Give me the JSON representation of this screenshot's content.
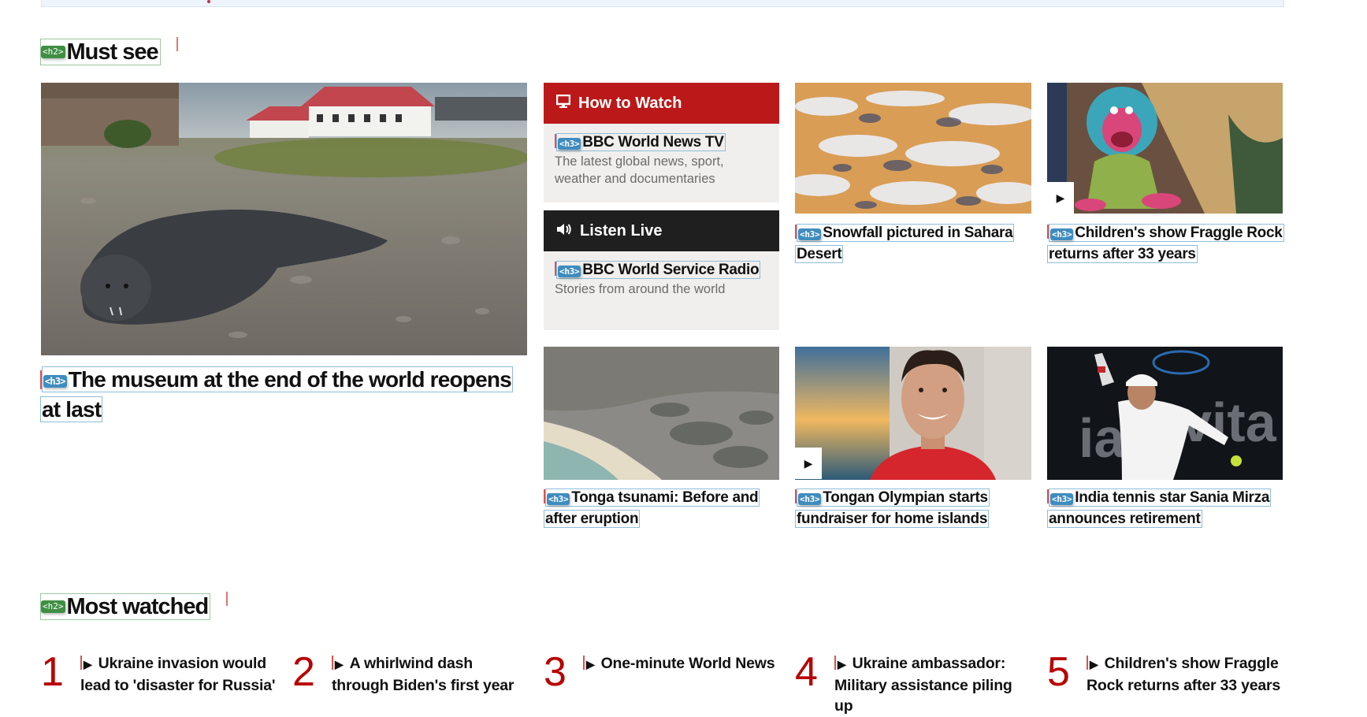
{
  "sections": {
    "must_see": {
      "tag": "<h2>",
      "title": "Must see"
    },
    "most_watched": {
      "tag": "<h2>",
      "title": "Most watched"
    }
  },
  "h3_tag": "<h3>",
  "main_story": {
    "headline": "The museum at the end of the world reopens at last",
    "image": "elephant-seal-pup-on-shingle-beach-with-red-roofed-buildings"
  },
  "how_to_watch": {
    "header_icon": "tv-monitor-icon",
    "header_label": "How to Watch",
    "header_color": "#bb1919",
    "title": "BBC World News TV",
    "description": "The latest global news, sport, weather and documentaries"
  },
  "listen_live": {
    "header_icon": "speaker-icon",
    "header_label": "Listen Live",
    "header_color": "#1f1f1f",
    "title": "BBC World Service Radio",
    "description": "Stories from around the world"
  },
  "stories": [
    {
      "headline": "Snowfall pictured in Sahara Desert",
      "is_video": false,
      "image": "aerial-snow-on-sand-dunes"
    },
    {
      "headline": "Children's show Fraggle Rock returns after 33 years",
      "is_video": true,
      "image": "fraggle-puppet"
    },
    {
      "headline": "Tonga tsunami: Before and after eruption",
      "is_video": false,
      "image": "aerial-tonga-coastline"
    },
    {
      "headline": "Tongan Olympian starts fundraiser for home islands",
      "is_video": true,
      "image": "smiling-man-red-shirt"
    },
    {
      "headline": "India tennis star Sania Mirza announces retirement",
      "is_video": false,
      "image": "tennis-player-serving"
    }
  ],
  "most_watched": [
    {
      "rank": "1",
      "title": "Ukraine invasion would lead to 'disaster for Russia'"
    },
    {
      "rank": "2",
      "title": "A whirlwind dash through Biden's first year"
    },
    {
      "rank": "3",
      "title": "One-minute World News"
    },
    {
      "rank": "4",
      "title": "Ukraine ambassador: Military assistance piling up"
    },
    {
      "rank": "5",
      "title": "Children's show Fraggle Rock returns after 33 years"
    }
  ],
  "play_icon": "▶"
}
